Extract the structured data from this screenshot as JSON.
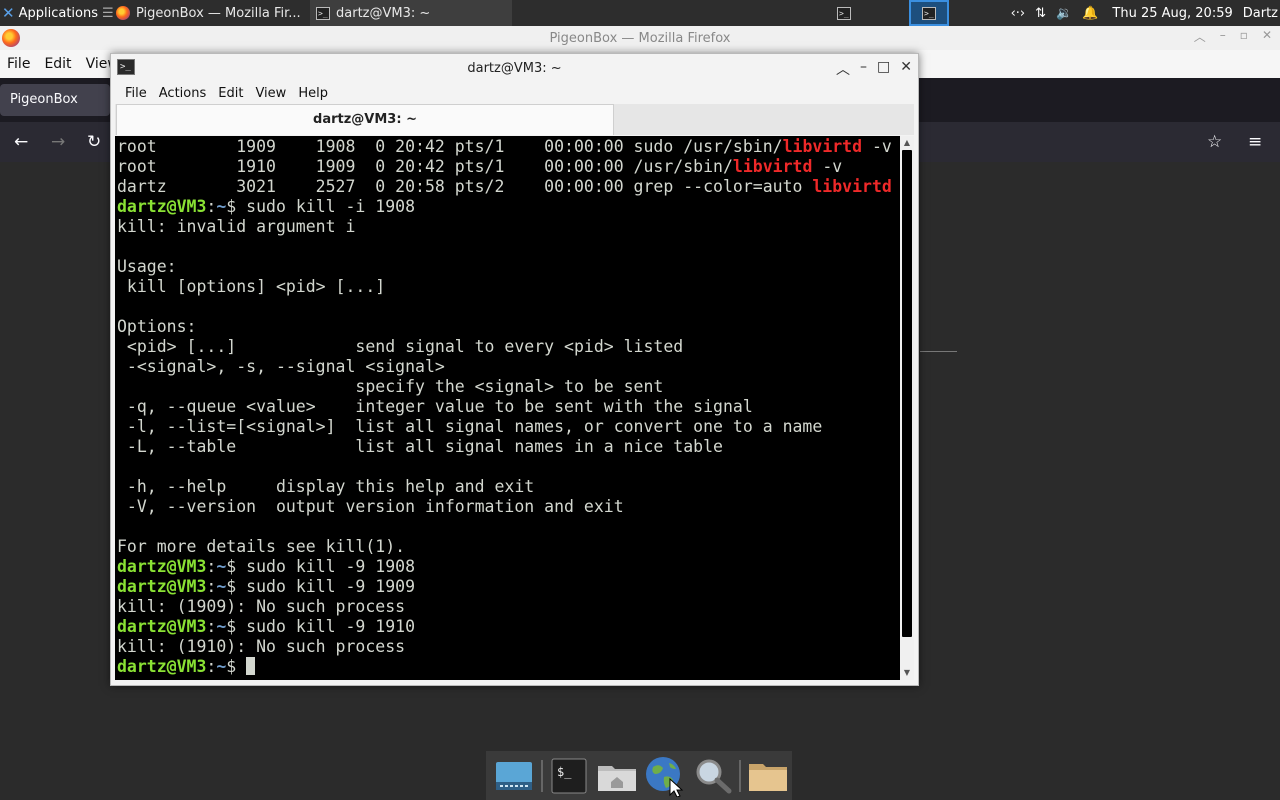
{
  "top_panel": {
    "applications_label": "Applications",
    "applications_suffix": "☰",
    "tasks": [
      {
        "label": "PigeonBox — Mozilla Fir...",
        "icon": "firefox-icon"
      },
      {
        "label": "dartz@VM3: ~",
        "icon": "terminal-icon"
      }
    ],
    "clock": "Thu 25 Aug, 20:59",
    "user": "Dartz",
    "tray_icons": [
      "network-arrows-icon",
      "network-updown-icon",
      "volume-icon",
      "notification-bell-icon"
    ]
  },
  "firefox": {
    "title": "PigeonBox — Mozilla Firefox",
    "menu": [
      "File",
      "Edit",
      "View"
    ],
    "tab_label": "PigeonBox"
  },
  "terminal": {
    "title": "dartz@VM3: ~",
    "menu": [
      "File",
      "Actions",
      "Edit",
      "View",
      "Help"
    ],
    "tab_label": "dartz@VM3: ~",
    "prompt_user": "dartz@VM3",
    "prompt_sep": ":",
    "prompt_path": "~",
    "prompt_dollar": "$ ",
    "lines": [
      {
        "type": "ps",
        "text": "root        1909    1908  0 20:42 pts/1    00:00:00 sudo /usr/sbin/",
        "hl": "libvirtd",
        "tail": " -v"
      },
      {
        "type": "ps",
        "text": "root        1910    1909  0 20:42 pts/1    00:00:00 /usr/sbin/",
        "hl": "libvirtd",
        "tail": " -v"
      },
      {
        "type": "ps",
        "text": "dartz       3021    2527  0 20:58 pts/2    00:00:00 grep --color=auto ",
        "hl": "libvirtd",
        "tail": ""
      },
      {
        "type": "cmd",
        "text": "sudo kill -i 1908"
      },
      {
        "type": "out",
        "text": "kill: invalid argument i"
      },
      {
        "type": "out",
        "text": ""
      },
      {
        "type": "out",
        "text": "Usage:"
      },
      {
        "type": "out",
        "text": " kill [options] <pid> [...]"
      },
      {
        "type": "out",
        "text": ""
      },
      {
        "type": "out",
        "text": "Options:"
      },
      {
        "type": "out",
        "text": " <pid> [...]            send signal to every <pid> listed"
      },
      {
        "type": "out",
        "text": " -<signal>, -s, --signal <signal>"
      },
      {
        "type": "out",
        "text": "                        specify the <signal> to be sent"
      },
      {
        "type": "out",
        "text": " -q, --queue <value>    integer value to be sent with the signal"
      },
      {
        "type": "out",
        "text": " -l, --list=[<signal>]  list all signal names, or convert one to a name"
      },
      {
        "type": "out",
        "text": " -L, --table            list all signal names in a nice table"
      },
      {
        "type": "out",
        "text": ""
      },
      {
        "type": "out",
        "text": " -h, --help     display this help and exit"
      },
      {
        "type": "out",
        "text": " -V, --version  output version information and exit"
      },
      {
        "type": "out",
        "text": ""
      },
      {
        "type": "out",
        "text": "For more details see kill(1)."
      },
      {
        "type": "cmd",
        "text": "sudo kill -9 1908"
      },
      {
        "type": "cmd",
        "text": "sudo kill -9 1909"
      },
      {
        "type": "out",
        "text": "kill: (1909): No such process"
      },
      {
        "type": "cmd",
        "text": "sudo kill -9 1910"
      },
      {
        "type": "out",
        "text": "kill: (1910): No such process"
      },
      {
        "type": "prompt",
        "text": ""
      }
    ]
  },
  "dock": {
    "items": [
      "show-desktop-icon",
      "terminal-icon",
      "home-folder-icon",
      "web-browser-icon",
      "search-icon",
      "files-folder-icon"
    ]
  }
}
